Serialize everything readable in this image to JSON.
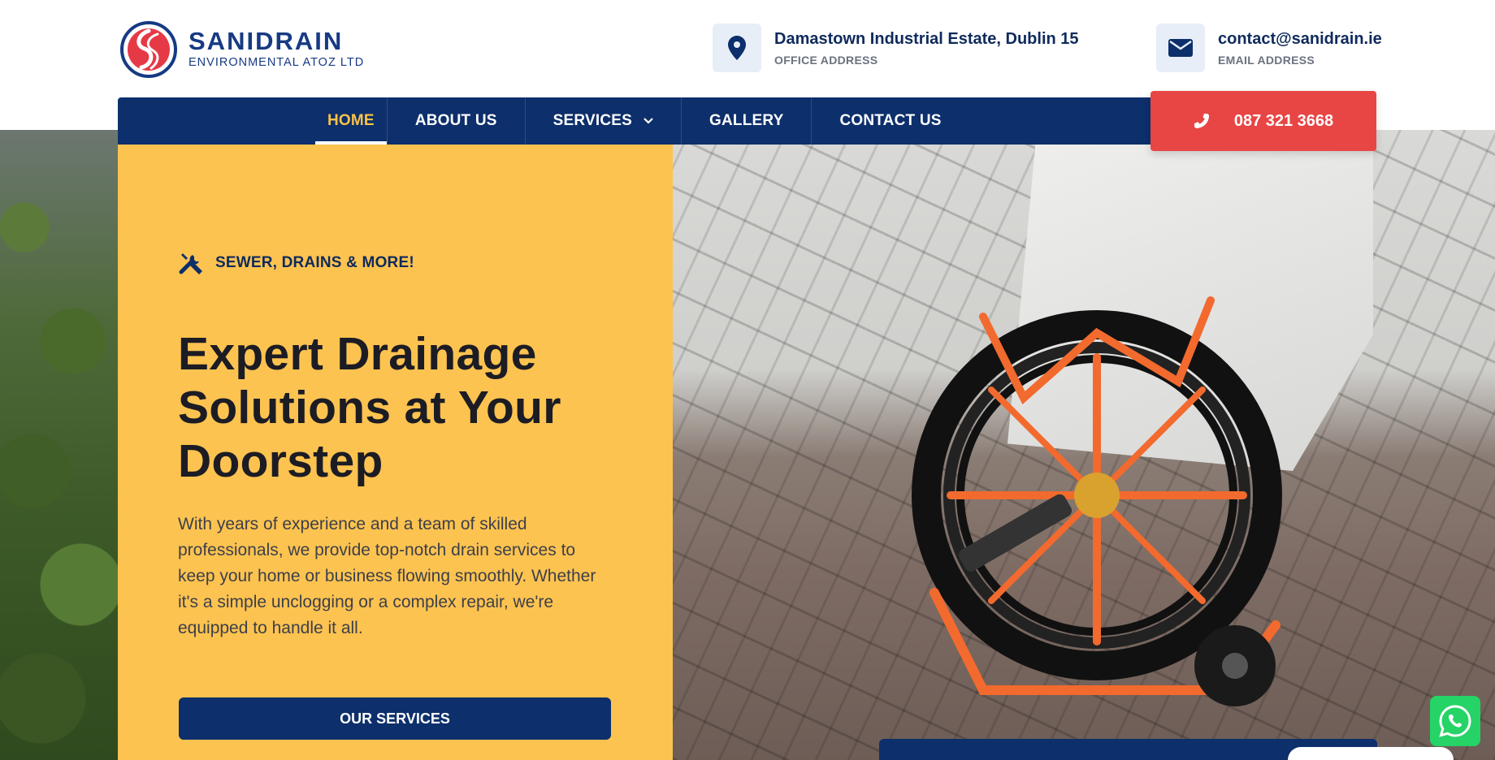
{
  "brand": {
    "name": "SANIDRAIN",
    "subtitle": "ENVIRONMENTAL ATOZ LTD",
    "primary_color": "#0d2f6b",
    "accent_color": "#fdc350",
    "cta_color": "#e84545"
  },
  "header": {
    "address": {
      "icon": "map-pin-icon",
      "value": "Damastown Industrial Estate, Dublin 15",
      "label": "OFFICE ADDRESS"
    },
    "email": {
      "icon": "envelope-icon",
      "value": "contact@sanidrain.ie",
      "label": "EMAIL ADDRESS"
    }
  },
  "nav": {
    "items": [
      {
        "label": "HOME",
        "active": true
      },
      {
        "label": "ABOUT US"
      },
      {
        "label": "SERVICES",
        "dropdown": true,
        "icon": "chevron-down-icon"
      },
      {
        "label": "GALLERY"
      },
      {
        "label": "CONTACT US"
      }
    ],
    "call": {
      "icon": "phone-icon",
      "label": "087 321 3668"
    }
  },
  "hero": {
    "tagline_icon": "tools-icon",
    "tagline": "SEWER, DRAINS & MORE!",
    "title_lines": [
      "Expert Drainage",
      "Solutions at Your",
      "Doorstep"
    ],
    "description": "With years of experience and a team of skilled professionals, we provide top-notch drain services to keep your home or business flowing smoothly. Whether it's a simple unclogging or a complex repair, we're equipped to handle it all.",
    "cta_label": "OUR SERVICES"
  },
  "floating": {
    "whatsapp_icon": "whatsapp-icon"
  }
}
